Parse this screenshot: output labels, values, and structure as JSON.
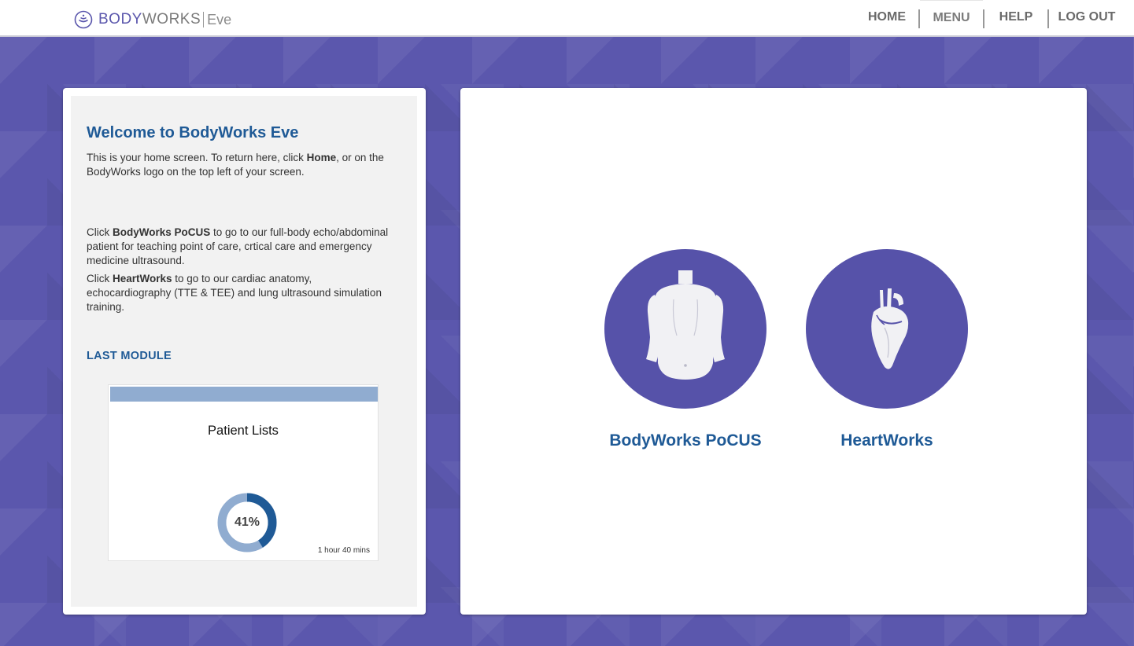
{
  "brand": {
    "name_part1": "BODY",
    "name_part2": "WORKS",
    "product": "Eve",
    "logo_icon": "bodyworks-logo-icon"
  },
  "nav": {
    "home": "HOME",
    "menu": "MENU",
    "help": "HELP",
    "logout": "LOG OUT"
  },
  "welcome": {
    "title": "Welcome to BodyWorks Eve",
    "p1_pre": "This is your home screen. To return here, click ",
    "p1_bold": "Home",
    "p1_post": ", or on the BodyWorks logo on the top left of your screen.",
    "p2_pre": "Click ",
    "p2_bold": "BodyWorks PoCUS",
    "p2_post": " to go to our full-body echo/abdominal patient for teaching point of care, crtical care and emergency medicine ultrasound.",
    "p3_pre": "Click ",
    "p3_bold": "HeartWorks",
    "p3_post": " to go to our cardiac anatomy, echocardiography (TTE & TEE) and lung ultrasound simulation training."
  },
  "last_module": {
    "heading": "LAST MODULE",
    "title": "Patient Lists",
    "progress_label": "41%",
    "progress_fraction": 0.41,
    "time": "1 hour 40 mins"
  },
  "products": [
    {
      "label": "BodyWorks PoCUS",
      "icon": "torso-icon"
    },
    {
      "label": "HeartWorks",
      "icon": "heart-icon"
    }
  ],
  "colors": {
    "accent": "#5652a9",
    "heading_blue": "#1f5a96",
    "progress_dark": "#1f5a96",
    "progress_light": "#90acd0"
  }
}
